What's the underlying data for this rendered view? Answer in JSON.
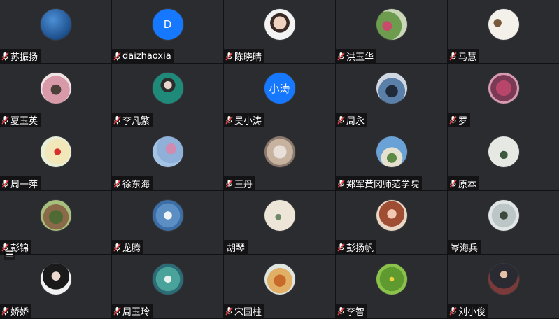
{
  "tiles": [
    {
      "name": "苏振扬",
      "avatar_text": "",
      "avatar_bg": "radial-gradient(circle at 40% 35%, #4c8fd6, #1d4f8c 70%, #0d2c55)",
      "muted": true
    },
    {
      "name": "daizhaoxia",
      "avatar_text": "D",
      "avatar_bg": "#1677ff",
      "muted": true
    },
    {
      "name": "陈晓晴",
      "avatar_text": "",
      "avatar_bg": "radial-gradient(circle at 50% 45%, #f0d2c0 0 28%, #3a2a26 29% 42%, #f3f3f3 43%)",
      "muted": true
    },
    {
      "name": "洪玉华",
      "avatar_text": "",
      "avatar_bg": "radial-gradient(circle at 35% 55%, #c84b6b 0 18%, #6e9c4f 19% 55%, #c9d6b8 56%)",
      "muted": true
    },
    {
      "name": "马慧",
      "avatar_text": "",
      "avatar_bg": "radial-gradient(circle at 30% 45%, #7a5a3a 0 14%, #f3f1ea 15%)",
      "muted": true
    },
    {
      "name": "夏玉英",
      "avatar_text": "",
      "avatar_bg": "radial-gradient(circle at 50% 55%, #4b3f3a 0 22%, #d89aa8 23% 60%, #efe3e4 61%)",
      "muted": true
    },
    {
      "name": "李凡繁",
      "avatar_text": "",
      "avatar_bg": "radial-gradient(circle at 50% 40%, #e8d6cc 0 16%, #2c2c2c 17% 30%, #1f8a7a 31%)",
      "muted": true
    },
    {
      "name": "吴小涛",
      "avatar_text": "小涛",
      "avatar_bg": "#1677ff",
      "muted": true
    },
    {
      "name": "周永",
      "avatar_text": "",
      "avatar_bg": "radial-gradient(circle at 50% 60%, #1f2a3b 0 25%, #5a7fa8 26% 55%, #cfd8e2 56%)",
      "muted": true
    },
    {
      "name": "罗",
      "avatar_text": "",
      "avatar_bg": "radial-gradient(circle at 50% 50%, #b8456a 0 35%, #7a3a55 36% 60%, #d79ab0 61%)",
      "muted": true
    },
    {
      "name": "周一萍",
      "avatar_text": "",
      "avatar_bg": "radial-gradient(circle at 55% 50%, #d8302a 0 14%, #f1e7b8 15% 55%, #e8eed8 56%)",
      "muted": true
    },
    {
      "name": "徐东海",
      "avatar_text": "",
      "avatar_bg": "radial-gradient(circle at 60% 40%, #d18ab0 0 20%, #8fb0d8 21% 55%, #a4c4e6 56%)",
      "muted": true
    },
    {
      "name": "王丹",
      "avatar_text": "",
      "avatar_bg": "radial-gradient(circle at 50% 50%, #e8e0d8 0 30%, #c7b2a0 31% 60%, #8c7a6e 61%)",
      "muted": true
    },
    {
      "name": "郑军黄冈师范学院",
      "avatar_text": "",
      "avatar_bg": "radial-gradient(circle at 50% 70%, #5c8a44 0 18%, #e6e0cf 19% 40%, #6aa2d8 41%)",
      "muted": true
    },
    {
      "name": "原本",
      "avatar_text": "",
      "avatar_bg": "radial-gradient(circle at 50% 60%, #3b5a3c 0 16%, #e5e8e3 17%)",
      "muted": true
    },
    {
      "name": "彭锦",
      "avatar_text": "",
      "avatar_bg": "radial-gradient(circle at 50% 55%, #4f6b34 0 30%, #8a6a48 31% 55%, #a7c07e 56%)",
      "muted": true
    },
    {
      "name": "龙腾",
      "avatar_text": "",
      "avatar_bg": "radial-gradient(circle at 50% 50%, #f1f4f7 0 18%, #5b8fc3 19% 55%, #3c6ea5 56%)",
      "muted": true
    },
    {
      "name": "胡琴",
      "avatar_text": "",
      "avatar_bg": "radial-gradient(circle at 45% 55%, #6c8a6a 0 12%, #ede6d8 13%)",
      "muted": false
    },
    {
      "name": "彭扬帆",
      "avatar_text": "",
      "avatar_bg": "radial-gradient(circle at 50% 45%, #f0c8b4 0 20%, #a04e33 21% 55%, #e9d6c4 56%)",
      "muted": true
    },
    {
      "name": "岑海兵",
      "avatar_text": "",
      "avatar_bg": "radial-gradient(circle at 50% 50%, #3c4a3e 0 18%, #bcc6c6 19% 55%, #e0e6e6 56%)",
      "muted": false
    },
    {
      "name": "娇娇",
      "avatar_text": "",
      "avatar_bg": "radial-gradient(circle at 50% 40%, #ecd8cc 0 18%, #1a1a1a 19% 55%, #f2f2f2 56%)",
      "muted": true
    },
    {
      "name": "周玉玲",
      "avatar_text": "",
      "avatar_bg": "radial-gradient(circle at 50% 50%, #e8f0ee 0 16%, #4aa39a 17% 55%, #2c6c76 56%)",
      "muted": true
    },
    {
      "name": "宋国柱",
      "avatar_text": "",
      "avatar_bg": "radial-gradient(circle at 50% 55%, #c86a2a 0 26%, #e1b066 27% 55%, #dfe5df 56%)",
      "muted": true
    },
    {
      "name": "李智",
      "avatar_text": "",
      "avatar_bg": "radial-gradient(circle at 50% 50%, #f0d23c 0 10%, #5e9a2f 11% 55%, #8bc34a 56%)",
      "muted": true
    },
    {
      "name": "刘小俊",
      "avatar_text": "",
      "avatar_bg": "radial-gradient(circle at 50% 35%, #e3c2a8 0 14%, #2a2a32 15% 55%, #7a3a3a 56%)",
      "muted": true
    }
  ],
  "menu_icon": "hamburger-menu-icon",
  "menu_glyph": "☰"
}
